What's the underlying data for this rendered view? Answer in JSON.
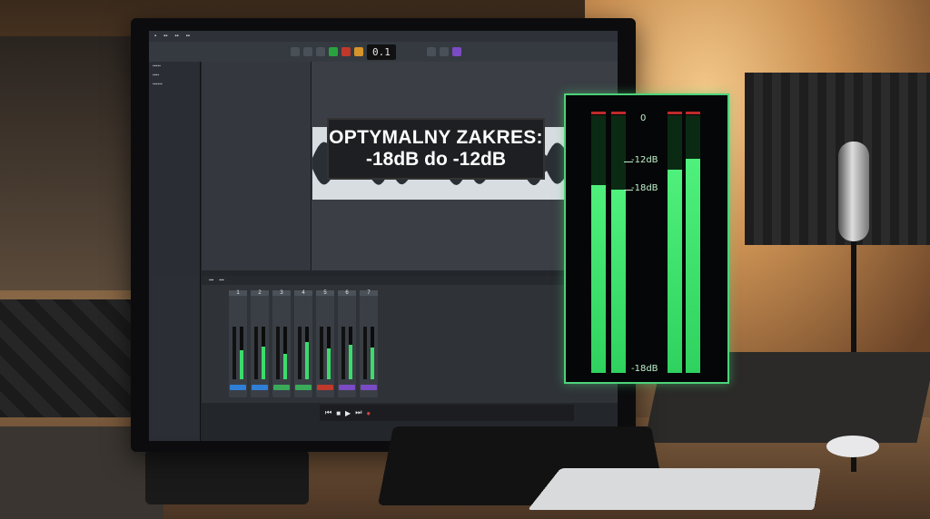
{
  "overlay": {
    "line1": "OPTYMALNY ZAKRES:",
    "line2": "-18dB do -12dB"
  },
  "meter": {
    "labels": {
      "zero": "0",
      "minus12": "-12dB",
      "minus18": "-18dB",
      "bottom": "-18dB"
    },
    "levels_fraction": [
      0.73,
      0.71,
      0.79,
      0.83
    ],
    "accent_color": "#4ed27a",
    "fill_color": "#3bdc6b"
  },
  "daw": {
    "time_display": "0.1",
    "mixer_channels": [
      "1",
      "2",
      "3",
      "4",
      "5",
      "6",
      "7"
    ],
    "mixer_levels_fraction": [
      0.55,
      0.62,
      0.48,
      0.7,
      0.58,
      0.66,
      0.6
    ]
  },
  "icons": [
    "play-icon",
    "record-icon",
    "loop-icon",
    "rewind-icon",
    "fast-forward-icon",
    "stop-icon"
  ]
}
